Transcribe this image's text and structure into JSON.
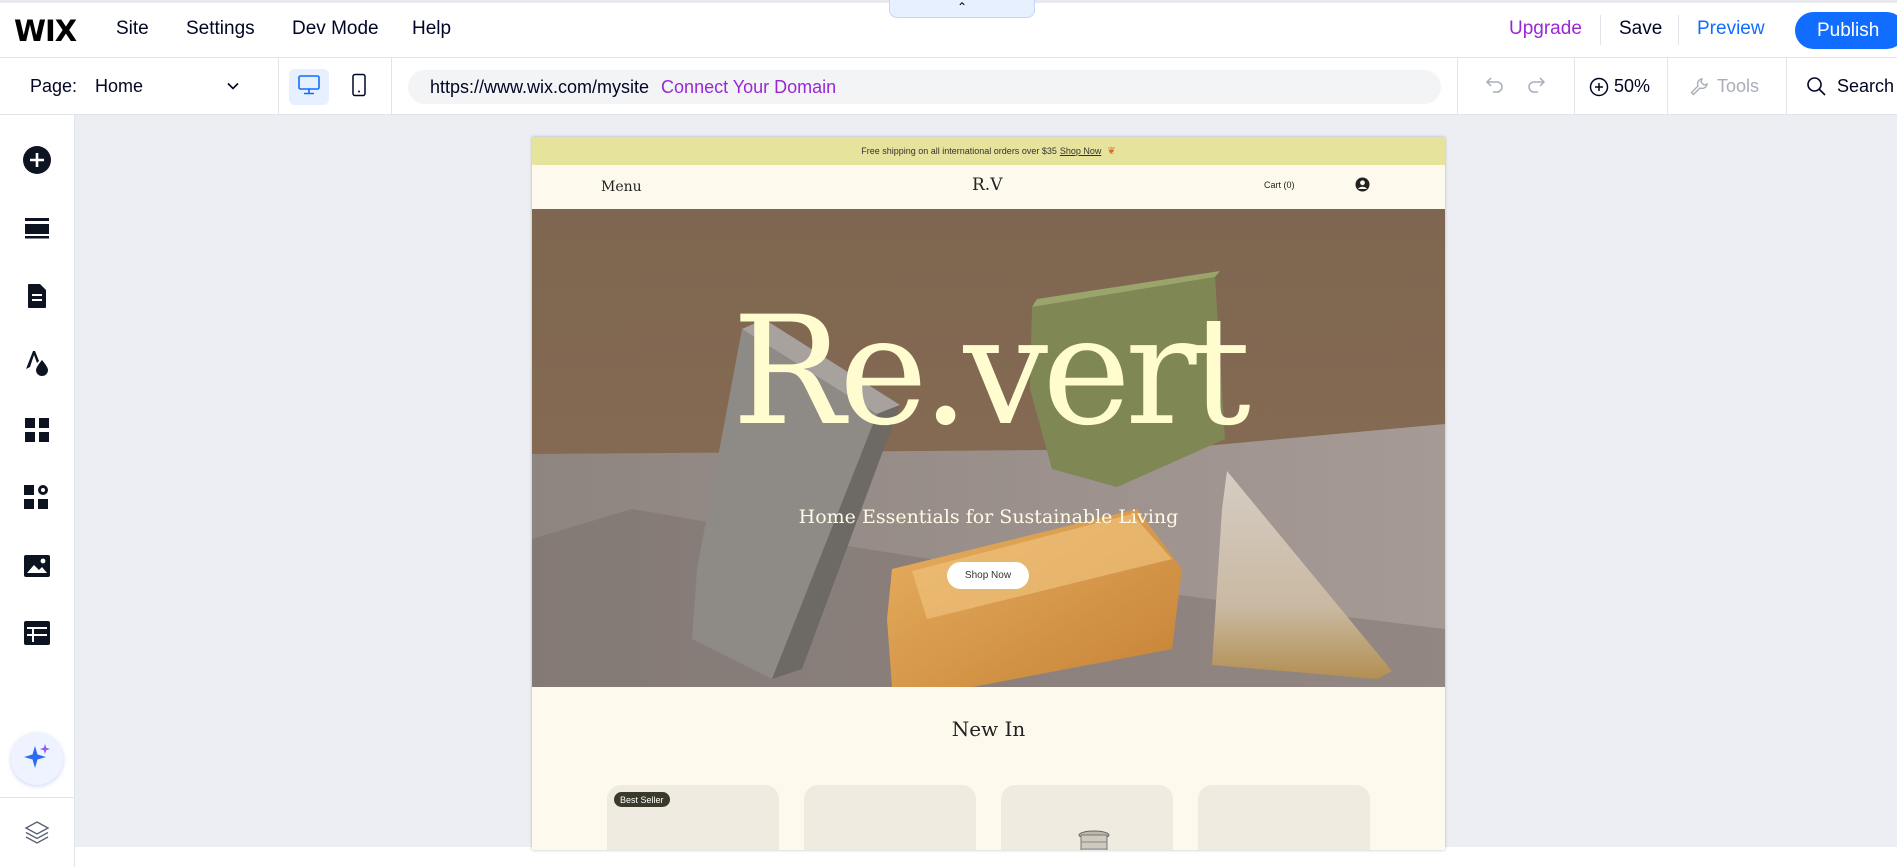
{
  "topbar": {
    "logo": "WIX",
    "menu": [
      "Site",
      "Settings",
      "Dev Mode",
      "Help"
    ],
    "collapse_glyph": "⌃",
    "upgrade": "Upgrade",
    "save": "Save",
    "preview": "Preview",
    "publish": "Publish",
    "colors": {
      "upgrade": "#9a27d5",
      "preview": "#116dff",
      "publish_bg": "#116dff"
    }
  },
  "pagebar": {
    "page_label": "Page:",
    "page_value": "Home",
    "url": "https://www.wix.com/mysite",
    "connect_domain": "Connect Your Domain",
    "zoom": "50%",
    "tools": "Tools",
    "search": "Search"
  },
  "sidebar": {
    "icons": [
      "add-icon",
      "sections-icon",
      "pages-icon",
      "theme-icon",
      "apps-icon",
      "business-apps-icon",
      "media-icon",
      "cms-icon",
      "ai-assistant-icon",
      "layers-icon"
    ]
  },
  "site": {
    "announcement": "Free shipping on all international orders over $35",
    "announcement_link": "Shop Now",
    "menu": "Menu",
    "brand": "R.V",
    "cart": "Cart (0)",
    "hero_title": "Re.vert",
    "hero_subtitle": "Home Essentials for Sustainable Living",
    "hero_button": "Shop Now",
    "section_title": "New In",
    "badge": "Best Seller",
    "colors": {
      "announcement_bg": "#e6e39c",
      "page_bg": "#fdfaed",
      "hero_title": "#fffcd0"
    }
  }
}
